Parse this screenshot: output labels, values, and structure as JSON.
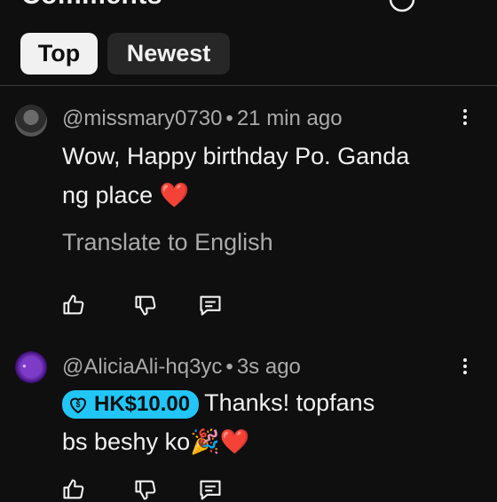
{
  "header": {
    "title": "Comments",
    "tabs": [
      {
        "label": "Top",
        "selected": true
      },
      {
        "label": "Newest",
        "selected": false
      }
    ]
  },
  "comments": [
    {
      "author": "@missmary0730",
      "time": "21 min ago",
      "text_line1": "Wow, Happy birthday Po. Ganda",
      "text_line2": "ng place",
      "emoji": "❤️",
      "translate_label": "Translate to English",
      "avatar_icon": "avatar-photo"
    },
    {
      "author": "@AliciaAli-hq3yc",
      "time": "3s ago",
      "super_thanks_amount": "HK$10.00",
      "text_line1": "Thanks! topfans",
      "text_line2": "bs beshy ko",
      "emoji": "🎉❤️",
      "avatar_icon": "avatar-purple"
    }
  ],
  "icons": [
    "more-vert-icon",
    "like-icon",
    "dislike-icon",
    "reply-icon",
    "super-thanks-icon"
  ],
  "colors": {
    "background": "#0f0f0f",
    "badge": "#21c6f6",
    "heart": "#ff1744",
    "secondary_text": "#aaaaaa"
  }
}
